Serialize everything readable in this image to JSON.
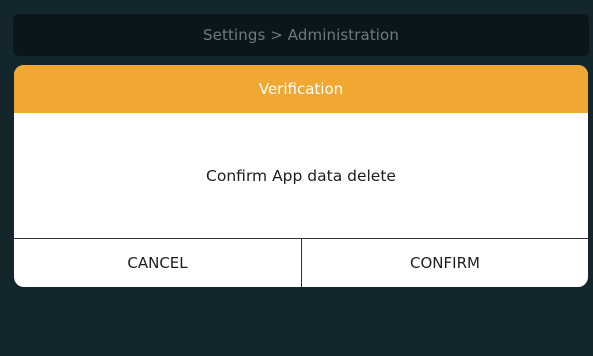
{
  "header": {
    "breadcrumb": "Settings > Administration"
  },
  "dialog": {
    "title": "Verification",
    "message": "Confirm App data delete",
    "cancel_label": "CANCEL",
    "confirm_label": "CONFIRM"
  },
  "colors": {
    "background": "#13262c",
    "header_bar": "#0b161b",
    "dialog_title_bar": "#f0a833",
    "dialog_body": "#ffffff"
  }
}
